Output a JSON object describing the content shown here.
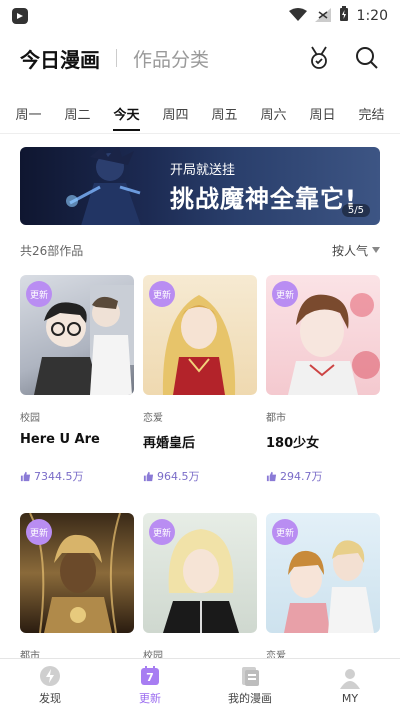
{
  "status_bar": {
    "time": "1:20"
  },
  "header": {
    "title": "今日漫画",
    "subtitle": "作品分类"
  },
  "day_tabs": [
    {
      "label": "周一",
      "active": false
    },
    {
      "label": "周二",
      "active": false
    },
    {
      "label": "今天",
      "active": true
    },
    {
      "label": "周四",
      "active": false
    },
    {
      "label": "周五",
      "active": false
    },
    {
      "label": "周六",
      "active": false
    },
    {
      "label": "周日",
      "active": false
    },
    {
      "label": "完结",
      "active": false
    }
  ],
  "banner": {
    "small_text": "开局就送挂",
    "big_text": "挑战魔神全靠它!",
    "page": "5/5"
  },
  "filter": {
    "count": "共26部作品",
    "sort": "按人气"
  },
  "badge_text": "更新",
  "comics": [
    {
      "genre": "校园",
      "title": "Here U Are",
      "likes": "7344.5万"
    },
    {
      "genre": "恋爱",
      "title": "再婚皇后",
      "likes": "964.5万"
    },
    {
      "genre": "都市",
      "title": "180少女",
      "likes": "294.7万"
    },
    {
      "genre": "都市",
      "title": "",
      "likes": ""
    },
    {
      "genre": "校园",
      "title": "",
      "likes": ""
    },
    {
      "genre": "恋爱",
      "title": "",
      "likes": ""
    }
  ],
  "bottom_nav": [
    {
      "label": "发现",
      "icon": "discover-icon",
      "active": false
    },
    {
      "label": "更新",
      "icon": "calendar-icon",
      "active": true,
      "badge": "7"
    },
    {
      "label": "我的漫画",
      "icon": "my-comics-icon",
      "active": false
    },
    {
      "label": "MY",
      "icon": "profile-icon",
      "active": false
    }
  ],
  "colors": {
    "accent": "#9b6cf0",
    "badge": "#b98df2",
    "likes": "#7a6cc8"
  }
}
